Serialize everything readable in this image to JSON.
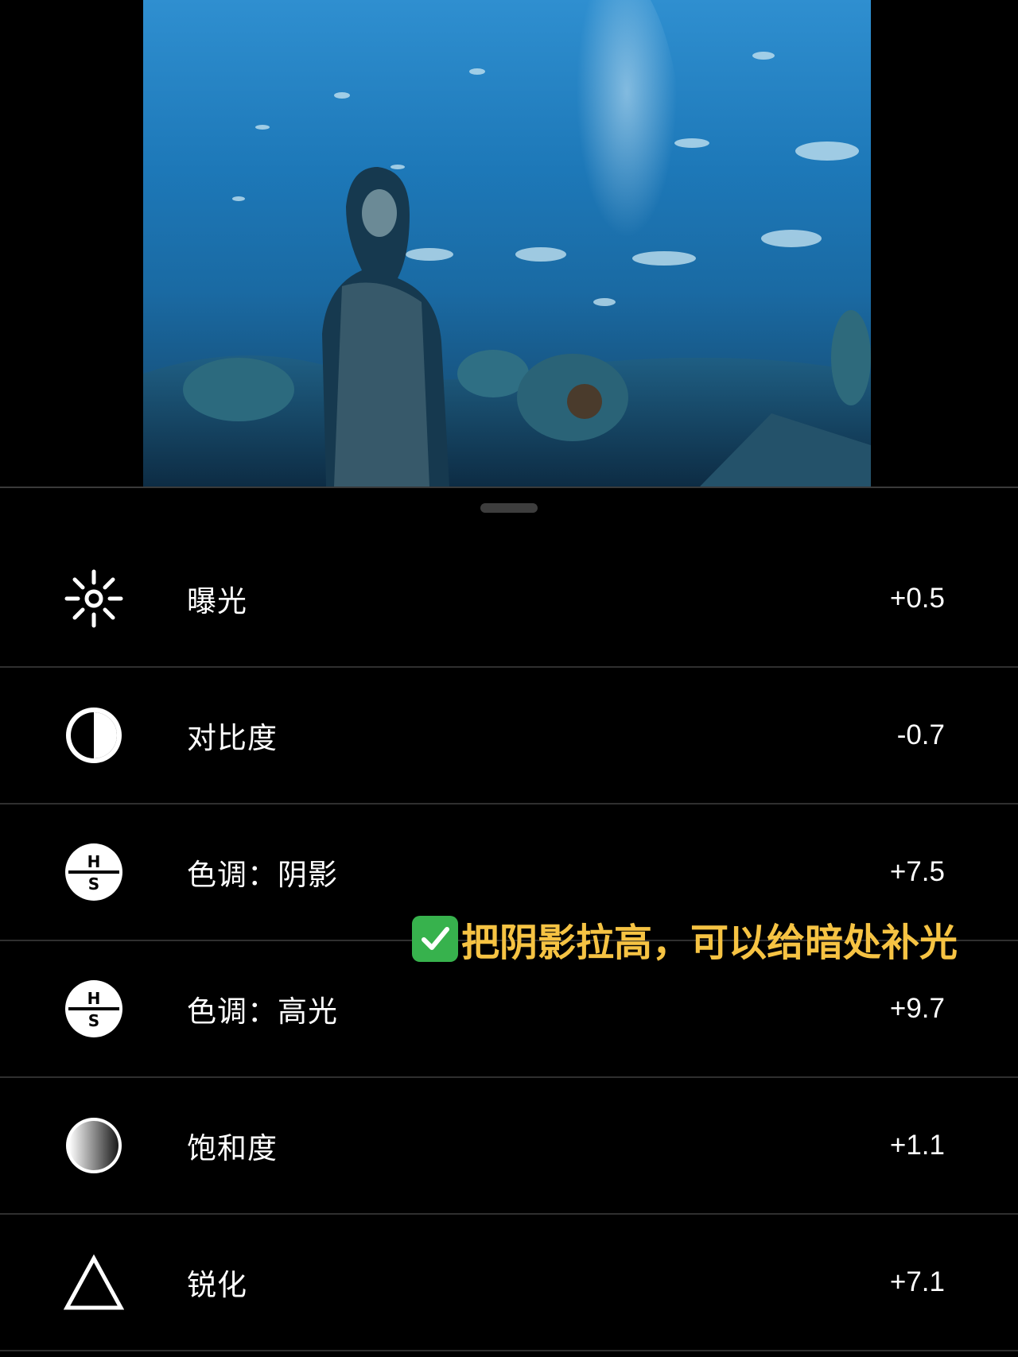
{
  "preview": {
    "alt": "aquarium photo preview",
    "icon": "photo-preview"
  },
  "sheet": {
    "grabber_icon": "drag-handle"
  },
  "adjustments": [
    {
      "icon": "sun-icon",
      "label": "曝光",
      "value": "+0.5"
    },
    {
      "icon": "contrast-icon",
      "label": "对比度",
      "value": "-0.7"
    },
    {
      "icon": "tone-shadows-icon",
      "label": "色调：阴影",
      "value": "+7.5"
    },
    {
      "icon": "tone-highlights-icon",
      "label": "色调：高光",
      "value": "+9.7"
    },
    {
      "icon": "saturation-icon",
      "label": "饱和度",
      "value": "+1.1"
    },
    {
      "icon": "sharpen-icon",
      "label": "锐化",
      "value": "+7.1"
    }
  ],
  "annotation": {
    "text": "把阴影拉高，可以给暗处补光",
    "icon": "check-mark-icon",
    "color": "#f6c343"
  },
  "icon_glyphs": {
    "hs_top": "H",
    "hs_bottom": "S"
  }
}
